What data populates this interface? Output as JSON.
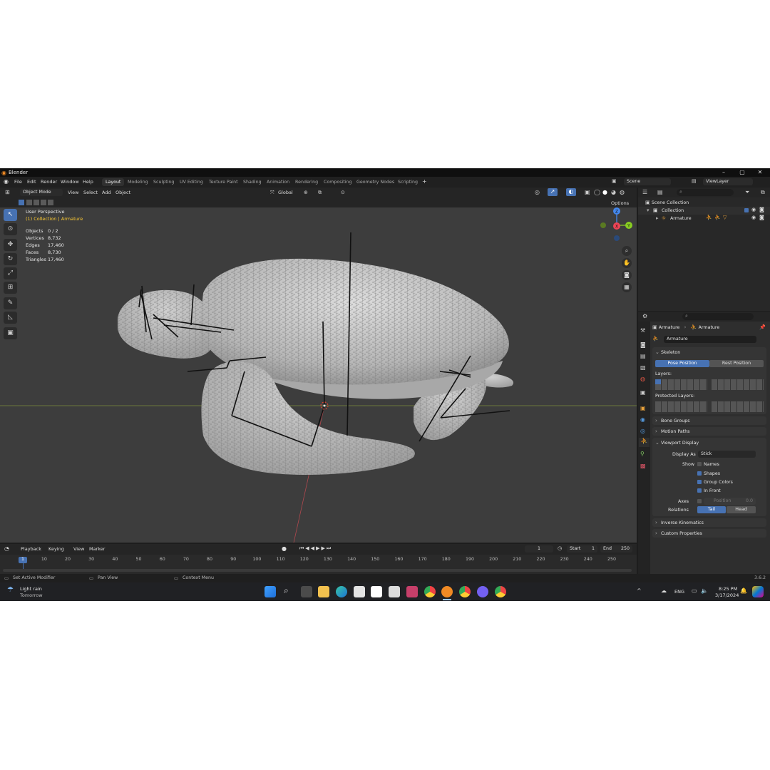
{
  "window": {
    "title": "Blender"
  },
  "menu": [
    "File",
    "Edit",
    "Render",
    "Window",
    "Help"
  ],
  "workspaces": [
    "Layout",
    "Modeling",
    "Sculpting",
    "UV Editing",
    "Texture Paint",
    "Shading",
    "Animation",
    "Rendering",
    "Compositing",
    "Geometry Nodes",
    "Scripting"
  ],
  "active_workspace": "Layout",
  "scene": {
    "name": "Scene",
    "view_layer": "ViewLayer"
  },
  "viewport_header": {
    "mode": "Object Mode",
    "menus": [
      "View",
      "Select",
      "Add",
      "Object"
    ],
    "orientation": "Global",
    "options": "Options"
  },
  "viewport": {
    "perspective": "User Perspective",
    "context": "(1) Collection | Armature",
    "stats": [
      {
        "label": "Objects",
        "value": "0 / 2"
      },
      {
        "label": "Vertices",
        "value": "8,732"
      },
      {
        "label": "Edges",
        "value": "17,460"
      },
      {
        "label": "Faces",
        "value": "8,730"
      },
      {
        "label": "Triangles",
        "value": "17,460"
      }
    ],
    "gizmo": {
      "z": "Z",
      "x": "X",
      "y": "Y"
    }
  },
  "outliner": {
    "root": "Scene Collection",
    "collection": "Collection",
    "object": "Armature"
  },
  "properties": {
    "breadcrumb": [
      "Armature",
      "Armature"
    ],
    "data_name": "Armature",
    "skeleton": {
      "title": "Skeleton",
      "pose_position": "Pose Position",
      "rest_position": "Rest Position",
      "layers_label": "Layers:",
      "protected_label": "Protected Layers:"
    },
    "collapsed_sections": [
      "Bone Groups",
      "Motion Paths"
    ],
    "viewport_display": {
      "title": "Viewport Display",
      "display_as_label": "Display As",
      "display_as": "Stick",
      "show_label": "Show",
      "names": "Names",
      "shapes": "Shapes",
      "group_colors": "Group Colors",
      "in_front": "In Front",
      "axes_label": "Axes",
      "position_label": "Position",
      "position_value": "0.0",
      "relations_label": "Relations",
      "tail": "Tail",
      "head": "Head"
    },
    "footer_sections": [
      "Inverse Kinematics",
      "Custom Properties"
    ]
  },
  "timeline": {
    "menus": [
      "Playback",
      "Keying",
      "View",
      "Marker"
    ],
    "current_frame": "1",
    "start_label": "Start",
    "start": "1",
    "end_label": "End",
    "end": "250",
    "ticks": [
      "1",
      "10",
      "20",
      "30",
      "40",
      "50",
      "60",
      "70",
      "80",
      "90",
      "100",
      "110",
      "120",
      "130",
      "140",
      "150",
      "160",
      "170",
      "180",
      "190",
      "200",
      "210",
      "220",
      "230",
      "240",
      "250"
    ]
  },
  "statusbar": {
    "items": [
      "Set Active Modifier",
      "Pan View",
      "Context Menu"
    ],
    "version": "3.6.2"
  },
  "taskbar": {
    "weather": "Light rain",
    "weather_sub": "Tomorrow",
    "lang": "ENG",
    "time": "8:25 PM",
    "date": "3/17/2024"
  },
  "colors": {
    "accent": "#4772b3",
    "viewport_bg": "#3d3d3d",
    "axis_x": "#ee4455",
    "axis_y": "#88cc22",
    "axis_z": "#4488ee",
    "context_text": "#ffcc33"
  }
}
